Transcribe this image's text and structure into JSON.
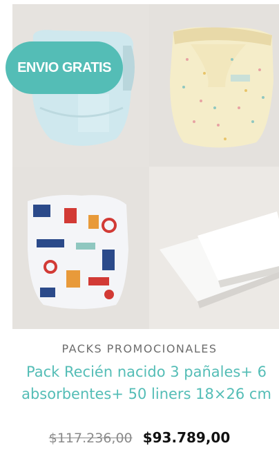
{
  "product": {
    "badge": "ENVIO GRATIS",
    "category": "PACKS PROMOCIONALES",
    "title": "Pack Recién nacido 3 pañales+ 6 absorbentes+ 50 liners 18×26 cm",
    "old_price": "$117.236,00",
    "new_price": "$93.789,00"
  },
  "colors": {
    "accent": "#54bdb6",
    "price": "#111111",
    "old_price": "#8a8a8a"
  },
  "images": [
    {
      "name": "light-blue-diaper-image"
    },
    {
      "name": "yellow-dotted-diaper-image"
    },
    {
      "name": "marine-print-diaper-image"
    },
    {
      "name": "white-liners-image"
    }
  ]
}
